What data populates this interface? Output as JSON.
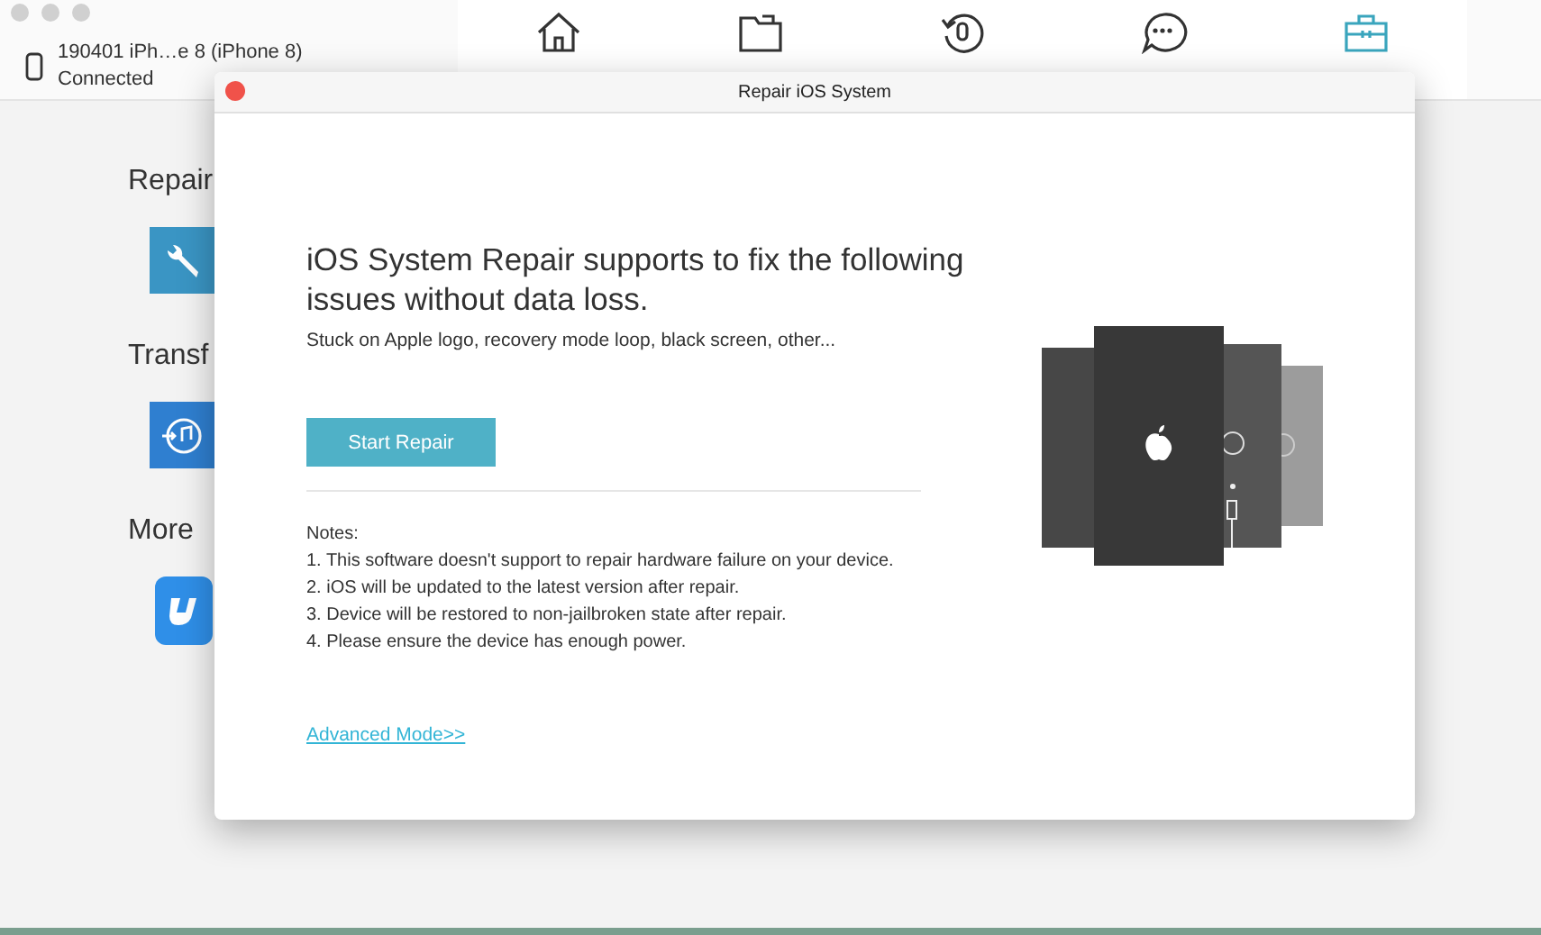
{
  "device": {
    "name": "190401 iPh…e 8 (iPhone 8)",
    "status": "Connected"
  },
  "nav": [
    {
      "kind": "home",
      "selected": false
    },
    {
      "kind": "folder",
      "selected": false
    },
    {
      "kind": "restore",
      "selected": false
    },
    {
      "kind": "chat",
      "selected": false
    },
    {
      "kind": "toolbox",
      "selected": true
    }
  ],
  "sections": [
    {
      "title": "Repair",
      "kind": "wrench"
    },
    {
      "title": "Transf",
      "kind": "music"
    },
    {
      "title": "More",
      "kind": "logo"
    }
  ],
  "dialog": {
    "title": "Repair iOS System",
    "heading": "iOS System Repair supports to fix the following issues without data loss.",
    "subtitle": "Stuck on Apple logo, recovery mode loop, black screen, other...",
    "button": "Start Repair",
    "notes_title": "Notes:",
    "notes": [
      "1. This software doesn't support to repair hardware failure on your device.",
      "2. iOS will be updated to the latest version after repair.",
      "3. Device will be restored to non-jailbroken state after repair.",
      "4. Please ensure the device has enough power."
    ],
    "link": "Advanced Mode>>"
  }
}
